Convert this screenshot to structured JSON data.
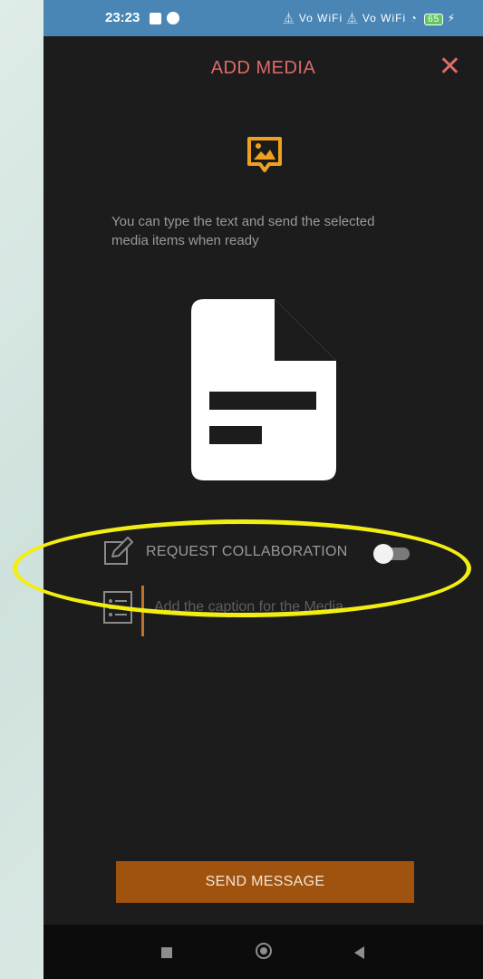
{
  "status_bar": {
    "time": "23:23",
    "network": "⏅ Vo WiFi ⏅ Vo WiFi ◔",
    "battery": "65",
    "charging": "⚡"
  },
  "header": {
    "title": "ADD MEDIA",
    "close_glyph": "✕"
  },
  "info_text": "You can type the text and send the selected media items when ready",
  "collaboration": {
    "label": "REQUEST COLLABORATION",
    "enabled": false
  },
  "caption": {
    "placeholder": "Add the caption for the Media",
    "value": ""
  },
  "send_button": {
    "label": "SEND MESSAGE"
  },
  "icons": {
    "media": "image-message-icon",
    "document": "document-icon",
    "edit": "edit-icon",
    "caption": "list-icon"
  },
  "colors": {
    "accent_red": "#e06a6a",
    "accent_orange": "#f0a020",
    "send_button": "#a0530f",
    "highlight": "#f2ee12",
    "status_bar": "#4a86b5"
  }
}
